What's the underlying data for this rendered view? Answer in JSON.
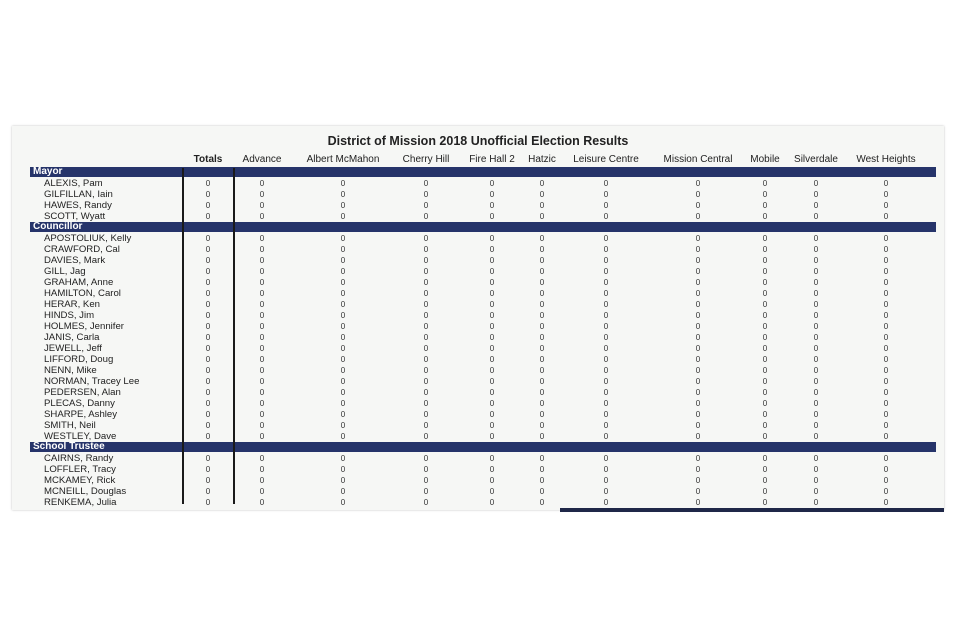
{
  "title": "District of Mission 2018 Unofficial Election Results",
  "columns": [
    "Totals",
    "Advance",
    "Albert McMahon",
    "Cherry Hill",
    "Fire Hall 2",
    "Hatzic",
    "Leisure Centre",
    "Mission Central",
    "Mobile",
    "Silverdale",
    "West Heights"
  ],
  "sections": [
    {
      "name": "Mayor",
      "candidates": [
        {
          "name": "ALEXIS, Pam",
          "values": [
            "0",
            "0",
            "0",
            "0",
            "0",
            "0",
            "0",
            "0",
            "0",
            "0",
            "0"
          ]
        },
        {
          "name": "GILFILLAN, Iain",
          "values": [
            "0",
            "0",
            "0",
            "0",
            "0",
            "0",
            "0",
            "0",
            "0",
            "0",
            "0"
          ]
        },
        {
          "name": "HAWES, Randy",
          "values": [
            "0",
            "0",
            "0",
            "0",
            "0",
            "0",
            "0",
            "0",
            "0",
            "0",
            "0"
          ]
        },
        {
          "name": "SCOTT, Wyatt",
          "values": [
            "0",
            "0",
            "0",
            "0",
            "0",
            "0",
            "0",
            "0",
            "0",
            "0",
            "0"
          ]
        }
      ]
    },
    {
      "name": "Councillor",
      "candidates": [
        {
          "name": "APOSTOLIUK, Kelly",
          "values": [
            "0",
            "0",
            "0",
            "0",
            "0",
            "0",
            "0",
            "0",
            "0",
            "0",
            "0"
          ]
        },
        {
          "name": "CRAWFORD, Cal",
          "values": [
            "0",
            "0",
            "0",
            "0",
            "0",
            "0",
            "0",
            "0",
            "0",
            "0",
            "0"
          ]
        },
        {
          "name": "DAVIES, Mark",
          "values": [
            "0",
            "0",
            "0",
            "0",
            "0",
            "0",
            "0",
            "0",
            "0",
            "0",
            "0"
          ]
        },
        {
          "name": "GILL, Jag",
          "values": [
            "0",
            "0",
            "0",
            "0",
            "0",
            "0",
            "0",
            "0",
            "0",
            "0",
            "0"
          ]
        },
        {
          "name": "GRAHAM, Anne",
          "values": [
            "0",
            "0",
            "0",
            "0",
            "0",
            "0",
            "0",
            "0",
            "0",
            "0",
            "0"
          ]
        },
        {
          "name": "HAMILTON, Carol",
          "values": [
            "0",
            "0",
            "0",
            "0",
            "0",
            "0",
            "0",
            "0",
            "0",
            "0",
            "0"
          ]
        },
        {
          "name": "HERAR, Ken",
          "values": [
            "0",
            "0",
            "0",
            "0",
            "0",
            "0",
            "0",
            "0",
            "0",
            "0",
            "0"
          ]
        },
        {
          "name": "HINDS, Jim",
          "values": [
            "0",
            "0",
            "0",
            "0",
            "0",
            "0",
            "0",
            "0",
            "0",
            "0",
            "0"
          ]
        },
        {
          "name": "HOLMES, Jennifer",
          "values": [
            "0",
            "0",
            "0",
            "0",
            "0",
            "0",
            "0",
            "0",
            "0",
            "0",
            "0"
          ]
        },
        {
          "name": "JANIS, Carla",
          "values": [
            "0",
            "0",
            "0",
            "0",
            "0",
            "0",
            "0",
            "0",
            "0",
            "0",
            "0"
          ]
        },
        {
          "name": "JEWELL, Jeff",
          "values": [
            "0",
            "0",
            "0",
            "0",
            "0",
            "0",
            "0",
            "0",
            "0",
            "0",
            "0"
          ]
        },
        {
          "name": "LIFFORD, Doug",
          "values": [
            "0",
            "0",
            "0",
            "0",
            "0",
            "0",
            "0",
            "0",
            "0",
            "0",
            "0"
          ]
        },
        {
          "name": "NENN, Mike",
          "values": [
            "0",
            "0",
            "0",
            "0",
            "0",
            "0",
            "0",
            "0",
            "0",
            "0",
            "0"
          ]
        },
        {
          "name": "NORMAN, Tracey Lee",
          "values": [
            "0",
            "0",
            "0",
            "0",
            "0",
            "0",
            "0",
            "0",
            "0",
            "0",
            "0"
          ]
        },
        {
          "name": "PEDERSEN, Alan",
          "values": [
            "0",
            "0",
            "0",
            "0",
            "0",
            "0",
            "0",
            "0",
            "0",
            "0",
            "0"
          ]
        },
        {
          "name": "PLECAS, Danny",
          "values": [
            "0",
            "0",
            "0",
            "0",
            "0",
            "0",
            "0",
            "0",
            "0",
            "0",
            "0"
          ]
        },
        {
          "name": "SHARPE, Ashley",
          "values": [
            "0",
            "0",
            "0",
            "0",
            "0",
            "0",
            "0",
            "0",
            "0",
            "0",
            "0"
          ]
        },
        {
          "name": "SMITH, Neil",
          "values": [
            "0",
            "0",
            "0",
            "0",
            "0",
            "0",
            "0",
            "0",
            "0",
            "0",
            "0"
          ]
        },
        {
          "name": "WESTLEY, Dave",
          "values": [
            "0",
            "0",
            "0",
            "0",
            "0",
            "0",
            "0",
            "0",
            "0",
            "0",
            "0"
          ]
        }
      ]
    },
    {
      "name": "School Trustee",
      "candidates": [
        {
          "name": "CAIRNS, Randy",
          "values": [
            "0",
            "0",
            "0",
            "0",
            "0",
            "0",
            "0",
            "0",
            "0",
            "0",
            "0"
          ]
        },
        {
          "name": "LOFFLER, Tracy",
          "values": [
            "0",
            "0",
            "0",
            "0",
            "0",
            "0",
            "0",
            "0",
            "0",
            "0",
            "0"
          ]
        },
        {
          "name": "MCKAMEY, Rick",
          "values": [
            "0",
            "0",
            "0",
            "0",
            "0",
            "0",
            "0",
            "0",
            "0",
            "0",
            "0"
          ]
        },
        {
          "name": "MCNEILL, Douglas",
          "values": [
            "0",
            "0",
            "0",
            "0",
            "0",
            "0",
            "0",
            "0",
            "0",
            "0",
            "0"
          ]
        },
        {
          "name": "RENKEMA, Julia",
          "values": [
            "0",
            "0",
            "0",
            "0",
            "0",
            "0",
            "0",
            "0",
            "0",
            "0",
            "0"
          ]
        }
      ]
    }
  ],
  "colors": {
    "section_bar": "#26346a",
    "section_text": "#ffffff",
    "sheet": "#f6f7f5"
  }
}
